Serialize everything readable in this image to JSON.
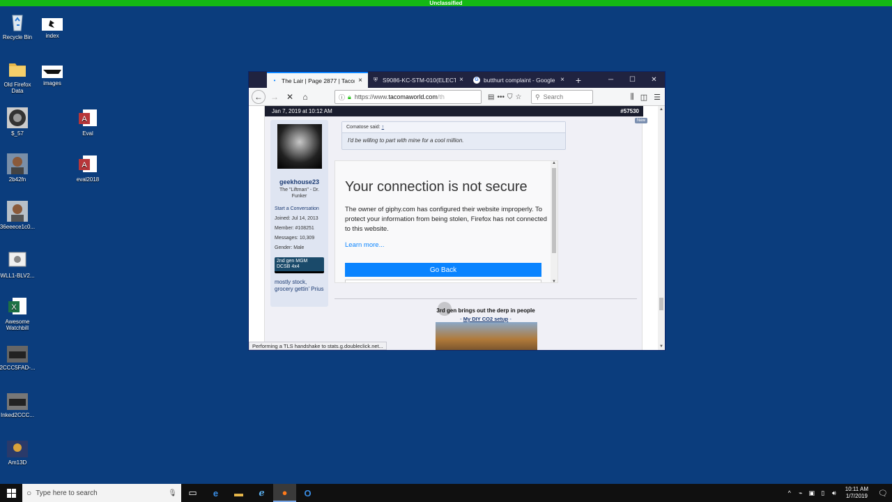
{
  "banner": "Unclassified",
  "desktop_icons": [
    {
      "label": "Recycle Bin",
      "icon": "recycle-bin-icon"
    },
    {
      "label": "index",
      "icon": "image-file-icon"
    },
    {
      "label": "Old Firefox Data",
      "icon": "folder-icon"
    },
    {
      "label": "images",
      "icon": "image-file-icon"
    },
    {
      "label": "$_57",
      "icon": "image-file-icon"
    },
    {
      "label": "Eval",
      "icon": "access-db-icon"
    },
    {
      "label": "2b42fn",
      "icon": "image-file-icon"
    },
    {
      "label": "eval2018",
      "icon": "access-db-icon"
    },
    {
      "label": "36eeece1c0...",
      "icon": "image-file-icon"
    },
    {
      "label": "WLL1-BLV2...",
      "icon": "settings-file-icon"
    },
    {
      "label": "Awesome Watchbill",
      "icon": "excel-icon"
    },
    {
      "label": "2CCC5FAD-...",
      "icon": "image-file-icon"
    },
    {
      "label": "Inked2CCC...",
      "icon": "image-file-icon"
    },
    {
      "label": "Am13D",
      "icon": "image-file-icon"
    }
  ],
  "browser": {
    "tabs": [
      {
        "title": "The Lair | Page 2877 | Tacoma",
        "active": true
      },
      {
        "title": "S9086-KC-STM-010(ELECTRIC",
        "active": false
      },
      {
        "title": "butthurt complaint - Google",
        "active": false
      }
    ],
    "url_prefix": "https://www.",
    "url_domain": "tacomaworld.com",
    "url_rest": "/th",
    "search_placeholder": "Search",
    "status_text": "Performing a TLS handshake to stats.g.doubleclick.net..."
  },
  "post": {
    "date": "Jan 7, 2019 at 10:12 AM",
    "number": "#57530",
    "new_badge": "New",
    "user": {
      "name": "geekhouse23",
      "title": "The \"Liftman\" - Dr. Funker",
      "start_conversation": "Start a Conversation",
      "joined_label": "Joined:",
      "joined": "Jul 14, 2013",
      "member_label": "Member:",
      "member": "#108251",
      "messages_label": "Messages:",
      "messages": "10,309",
      "gender_label": "Gender:",
      "gender": "Male",
      "truck": "2nd gen MGM DCSB 4x4",
      "signature": "mostly stock, grocery gettin' Prius"
    },
    "quote": {
      "author": "Comatose said:",
      "arrow": "↑",
      "text": "I'd be willing to part with mine for a cool million."
    },
    "error": {
      "title": "Your connection is not secure",
      "body": "The owner of giphy.com has configured their website improperly. To protect your information from being stolen, Firefox has not connected to this website.",
      "learn_more": "Learn more...",
      "go_back": "Go Back"
    },
    "sig_line": "3rd gen brings out the derp in people",
    "sig_link_dash1": "- ",
    "sig_link": "My DIY CO2 setup",
    "sig_link_dash2": " -"
  },
  "taskbar": {
    "search_placeholder": "Type here to search",
    "time": "10:11 AM",
    "date": "1/7/2019"
  }
}
